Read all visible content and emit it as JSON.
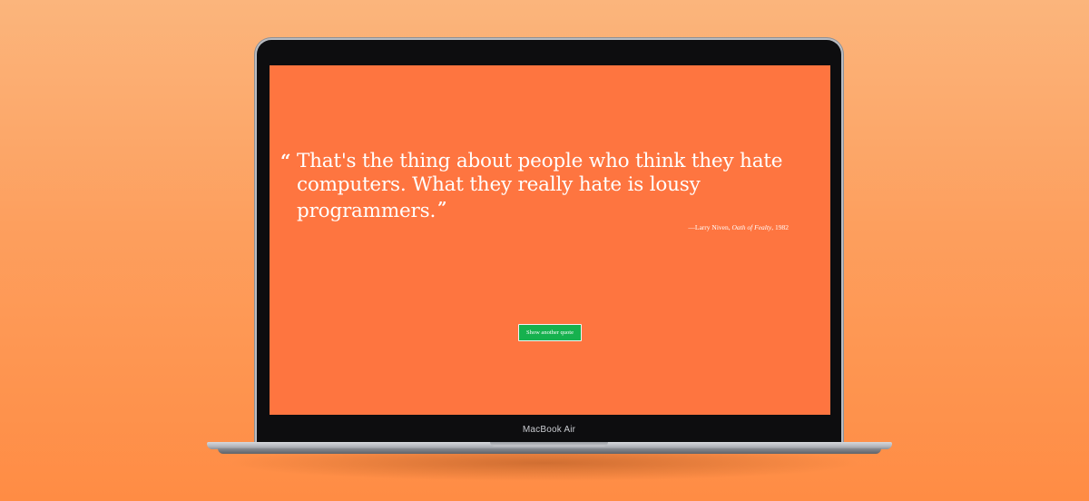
{
  "device": {
    "model_label": "MacBook Air"
  },
  "quote": {
    "open_mark": "“",
    "text": "That's the thing about people who think they hate computers. What they really hate is lousy programmers.",
    "close_mark": "”"
  },
  "attribution": {
    "prefix": "—Larry Niven, ",
    "work": "Oath of Fealty",
    "suffix": ", 1982"
  },
  "button": {
    "label": "Show another quote"
  },
  "colors": {
    "background_gradient_top": "#fbb57c",
    "background_gradient_bottom": "#ff8c44",
    "screen": "#fe7540",
    "button": "#16b14e",
    "text": "#ffffff"
  }
}
